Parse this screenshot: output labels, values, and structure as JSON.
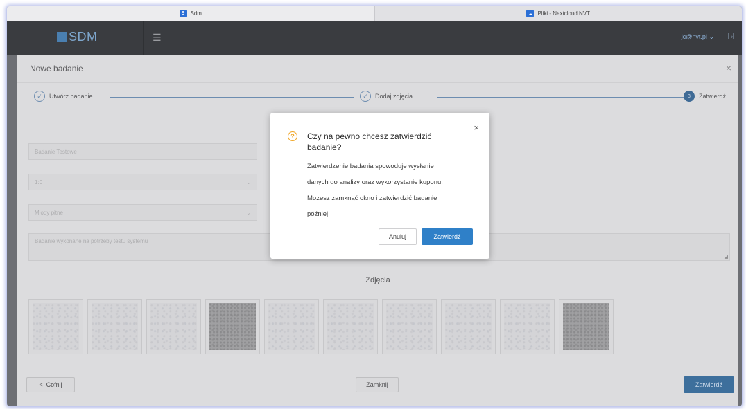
{
  "browser": {
    "tabs": [
      {
        "label": "Sdm",
        "icon": "sdm-favicon",
        "active": true
      },
      {
        "label": "Pliki - Nextcloud NVT",
        "icon": "nextcloud-favicon",
        "active": false
      }
    ]
  },
  "appbar": {
    "logo_text": "SDM",
    "user": "jc@nvt.pl",
    "user_caret": "⌄",
    "menu_icon": "☰",
    "logout_icon": "⍈"
  },
  "modal": {
    "title": "Nowe badanie",
    "close": "×",
    "steps": [
      {
        "label": "Utwórz badanie",
        "marker": "✓",
        "state": "done"
      },
      {
        "label": "Dodaj zdjęcia",
        "marker": "✓",
        "state": "done"
      },
      {
        "label": "Zatwierdź",
        "marker": "3",
        "state": "current"
      }
    ],
    "form": {
      "name_value": "Badanie Testowe",
      "ratio_value": "1:0",
      "type_value": "Miody pitne",
      "description_value": "Badanie wykonane na potrzeby testu systemu",
      "select_caret": "⌄",
      "resize_glyph": "◢"
    },
    "photos_title": "Zdjęcia",
    "photo_count": 10,
    "footer": {
      "back_icon": "<",
      "back_label": "Cofnij",
      "close_label": "Zamknij",
      "confirm_label": "Zatwierdź"
    }
  },
  "confirm_dialog": {
    "icon": "?",
    "close": "×",
    "title": "Czy na pewno chcesz zatwierdzić badanie?",
    "body_lines": [
      "Zatwierdzenie badania spowoduje wysłanie",
      "danych do analizy oraz wykorzystanie kuponu.",
      "Możesz zamknąć okno i zatwierdzić badanie",
      "później"
    ],
    "cancel_label": "Anuluj",
    "confirm_label": "Zatwierdź"
  },
  "colors": {
    "accent": "#2f80c8",
    "warning": "#f0a626",
    "appbar": "#3a3c40"
  }
}
